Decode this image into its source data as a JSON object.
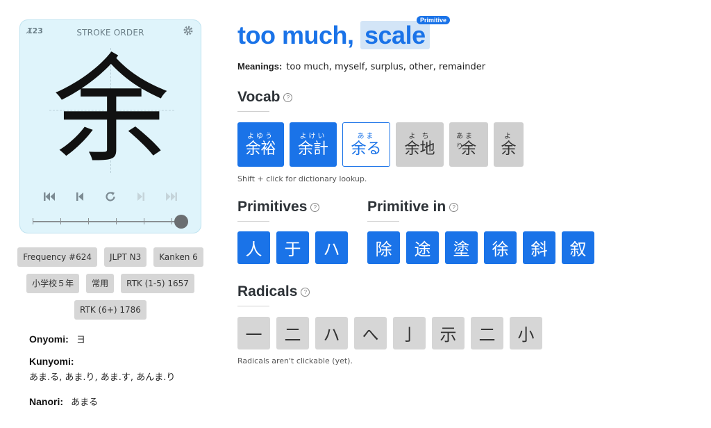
{
  "stroke_card": {
    "title": "STROKE ORDER",
    "numbers_toggle": "1̸23",
    "kanji": "余",
    "controls": [
      "first-icon",
      "prev-icon",
      "replay-icon",
      "next-icon",
      "last-icon"
    ],
    "progress": 1.0
  },
  "badges": [
    "Frequency #624",
    "JLPT N3",
    "Kanken 6",
    "小学校５年",
    "常用",
    "RTK (1-5) 1657",
    "RTK (6+) 1786"
  ],
  "readings": {
    "onyomi_label": "Onyomi:",
    "onyomi_value": "ヨ",
    "kunyomi_label": "Kunyomi:",
    "kunyomi_value": "あま.る, あま.り, あま.す, あんま.り",
    "nanori_label": "Nanori:",
    "nanori_value": "あまる"
  },
  "header": {
    "title_prefix": "too much, ",
    "title_highlight": "scale",
    "primitive_tag": "Primitive",
    "meanings_label": "Meanings:",
    "meanings_value": "too much, myself, surplus, other, remainder"
  },
  "vocab": {
    "heading": "Vocab",
    "items": [
      {
        "furigana": "よゆう",
        "word": "余裕",
        "style": "blue"
      },
      {
        "furigana": "よけい",
        "word": "余計",
        "style": "blue"
      },
      {
        "furigana": "あま",
        "word": "余る",
        "style": "outline"
      },
      {
        "furigana": "よ ち",
        "word": "余地",
        "style": "gray"
      },
      {
        "furigana": "あまり",
        "word": "余",
        "style": "gray"
      },
      {
        "furigana": "よ",
        "word": "余",
        "style": "gray"
      }
    ],
    "hint": "Shift + click for dictionary lookup."
  },
  "primitives": {
    "heading": "Primitives",
    "items": [
      "人",
      "于",
      "ハ"
    ]
  },
  "primitive_in": {
    "heading": "Primitive in",
    "items": [
      "除",
      "途",
      "塗",
      "徐",
      "斜",
      "叙"
    ]
  },
  "radicals": {
    "heading": "Radicals",
    "items": [
      "一",
      "二",
      "ハ",
      "へ",
      "亅",
      "示",
      "二",
      "小"
    ],
    "note": "Radicals aren't clickable (yet)."
  },
  "colors": {
    "accent": "#1a73e8",
    "card_bg": "#dff4fb",
    "tile_gray": "#d6d6d6"
  }
}
